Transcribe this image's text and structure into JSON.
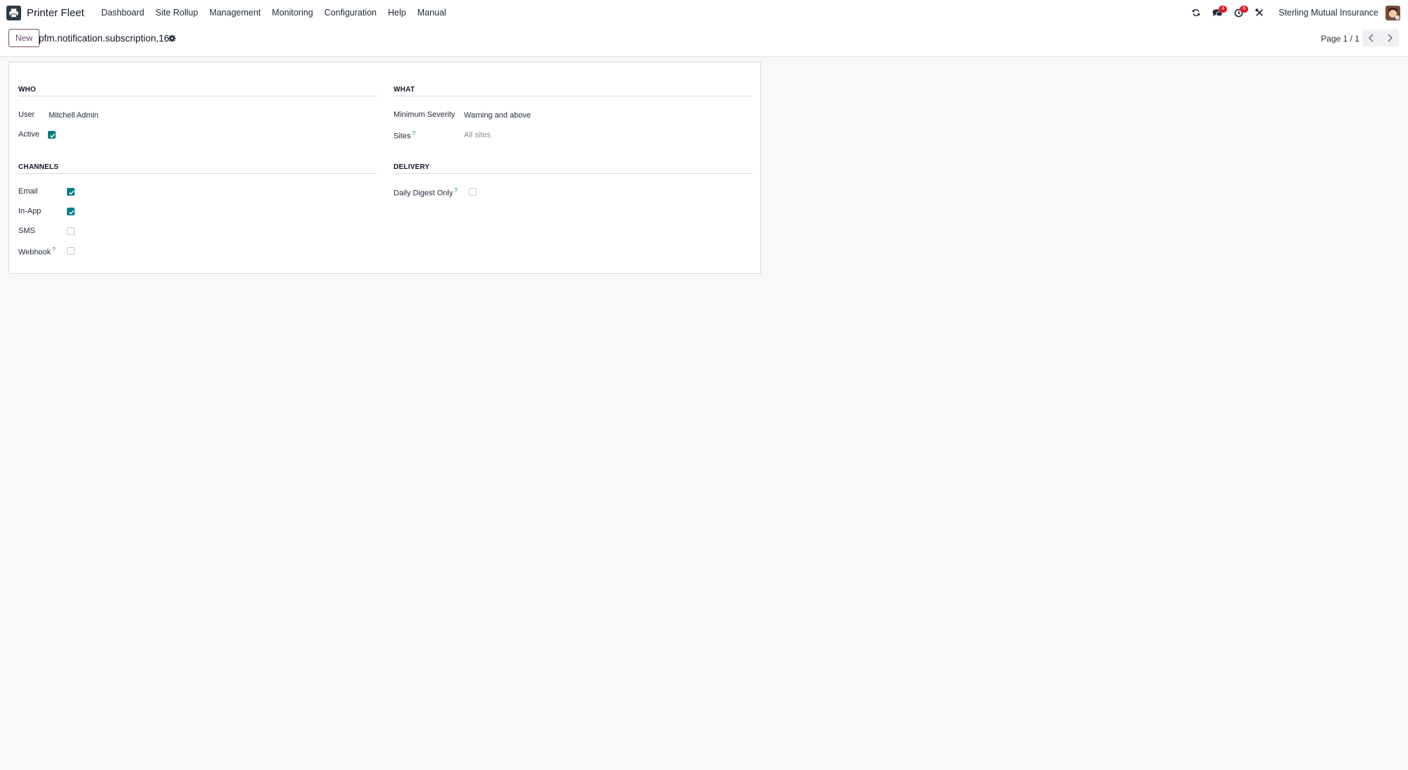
{
  "navbar": {
    "app_name": "Printer Fleet",
    "menu": [
      "Dashboard",
      "Site Rollup",
      "Management",
      "Monitoring",
      "Configuration",
      "Help",
      "Manual"
    ],
    "icons": {
      "sync": "sync-icon",
      "messages": "chat-bubbles-icon",
      "activities": "clock-icon",
      "debug": "tools-icon"
    },
    "messages_badge": "4",
    "activities_badge": "6",
    "company": "Sterling Mutual Insurance",
    "badge_color": "#e01b24"
  },
  "control_panel": {
    "new_label": "New",
    "record_title": "pfm.notification.subscription,16",
    "pager": "Page 1 / 1"
  },
  "form": {
    "who": {
      "title": "WHO",
      "user_label": "User",
      "user_value": "Mitchell Admin",
      "active_label": "Active",
      "active": true
    },
    "what": {
      "title": "WHAT",
      "severity_label": "Minimum Severity",
      "severity_value": "Warning and above",
      "sites_label": "Sites",
      "sites_placeholder": "All sites"
    },
    "channels": {
      "title": "CHANNELS",
      "items": [
        {
          "label": "Email",
          "checked": true,
          "help": false
        },
        {
          "label": "In-App",
          "checked": true,
          "help": false
        },
        {
          "label": "SMS",
          "checked": false,
          "help": false
        },
        {
          "label": "Webhook",
          "checked": false,
          "help": true
        }
      ]
    },
    "delivery": {
      "title": "DELIVERY",
      "digest_label": "Daily Digest Only",
      "digest": false
    },
    "help_mark": "?"
  },
  "colors": {
    "accent": "#017e84",
    "brand": "#714b67"
  }
}
